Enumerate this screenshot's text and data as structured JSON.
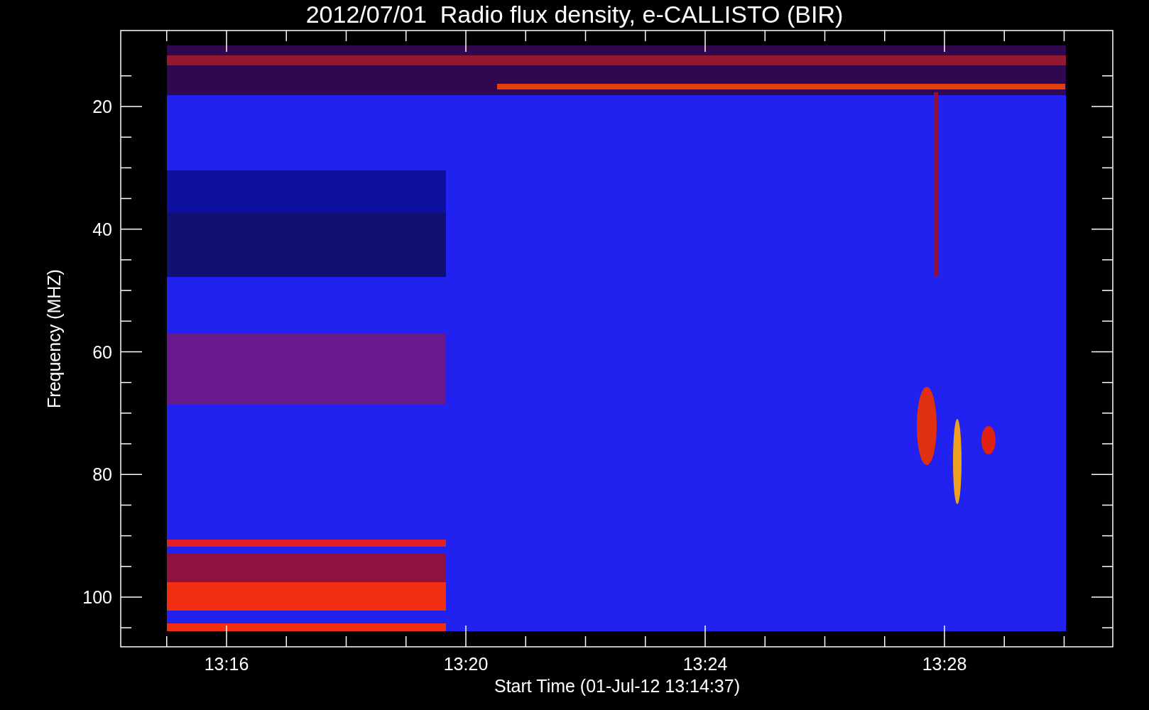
{
  "title": "2012/07/01  Radio flux density, e-CALLISTO (BIR)",
  "y_axis": {
    "label": "Frequency (MHZ)",
    "tick_labels": [
      "20",
      "40",
      "60",
      "80",
      "100"
    ]
  },
  "x_axis": {
    "label": "Start Time (01-Jul-12 13:14:37)",
    "tick_labels": [
      "13:16",
      "13:20",
      "13:24",
      "13:28"
    ]
  }
}
